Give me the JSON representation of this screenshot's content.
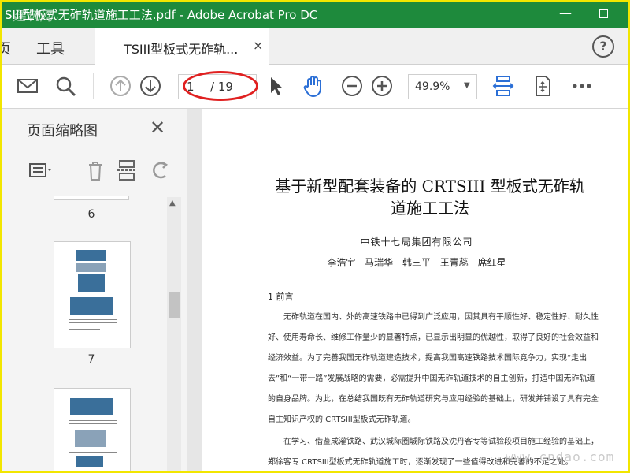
{
  "window": {
    "title": "SIII型板式无砟轨道施工工法.pdf - Adobe Acrobat Pro DC",
    "watermark": "建筑网",
    "min_label": "—"
  },
  "tabs": {
    "home": "页",
    "tools": "工具",
    "document": "TSIII型板式无砟轨...",
    "close": "×",
    "help": "?"
  },
  "toolbar": {
    "page_current": "1",
    "page_total": "/ 19",
    "zoom": "49.9%",
    "icons": [
      "mail-icon",
      "search-icon",
      "prev-page-icon",
      "next-page-icon",
      "select-cursor-icon",
      "hand-tool-icon",
      "zoom-out-icon",
      "zoom-in-icon",
      "fit-width-icon",
      "scroll-mode-icon",
      "more-icon"
    ],
    "accent": "#2b6fd6"
  },
  "panel": {
    "title": "页面缩略图",
    "close": "✕",
    "thumbnails": [
      {
        "number": "6"
      },
      {
        "number": "7"
      },
      {
        "number": ""
      }
    ]
  },
  "document": {
    "title_line1": "基于新型配套装备的 CRTSIII 型板式无砟轨",
    "title_line2": "道施工工法",
    "organization": "中铁十七局集团有限公司",
    "authors": "李浩宇 马瑞华 韩三平 王青蕊 席红星",
    "section_heading": "1  前言",
    "paragraph1": "无砟轨道在国内、外的高速铁路中已得到广泛应用，因其具有平顺性好、稳定性好、耐久性好、使用寿命长、维修工作量少的显著特点，已显示出明显的优越性，取得了良好的社会效益和经济效益。为了完善我国无砟轨道建造技术，提高我国高速铁路技术国际竞争力，实现“走出去”和“一带一路”发展战略的需要，必需提升中国无砟轨道技术的自主创新，打造中国无砟轨道的自身品牌。为此，在总结我国既有无砟轨道研究与应用经验的基础上，研发并铺设了具有完全自主知识产权的 CRTSIII型板式无砟轨道。",
    "paragraph2": "在学习、借鉴成灌铁路、武汉城际圈城际铁路及沈丹客专等试验段项目施工经验的基础上，郑徐客专 CRTSIII型板式无砟轨道施工时，逐渐发现了一些值得改进和完善的不足之处。"
  },
  "site_watermark": "www.cndao.com"
}
